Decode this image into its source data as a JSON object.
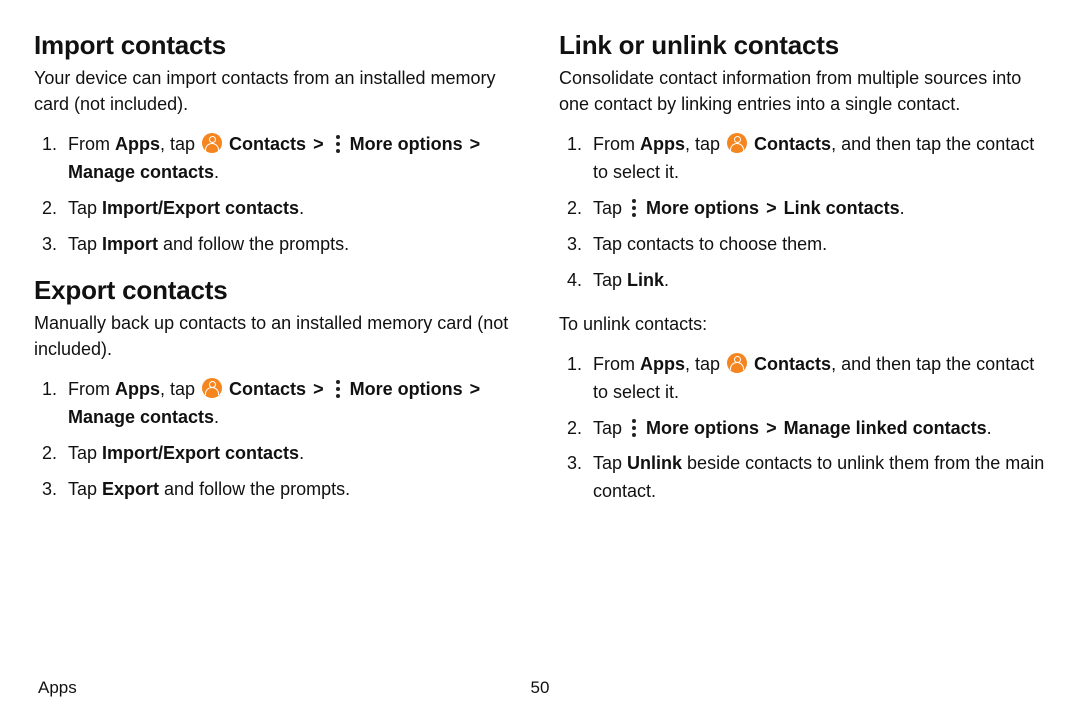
{
  "footer": {
    "section": "Apps",
    "page": "50"
  },
  "left": {
    "import": {
      "heading": "Import contacts",
      "intro": "Your device can import contacts from an installed memory card (not included).",
      "steps": {
        "s1": {
          "prefix": "From ",
          "apps": "Apps",
          "tap": ", tap ",
          "contacts": "Contacts",
          "moreoptions": "More options",
          "manage": "Manage contacts",
          "dot": "."
        },
        "s2": {
          "tap": "Tap ",
          "b": "Import/Export contacts",
          "dot": "."
        },
        "s3": {
          "tap": "Tap ",
          "b": "Import",
          "rest": " and follow the prompts."
        }
      }
    },
    "export": {
      "heading": "Export contacts",
      "intro": "Manually back up contacts to an installed memory card (not included).",
      "steps": {
        "s1": {
          "prefix": "From ",
          "apps": "Apps",
          "tap": ", tap ",
          "contacts": "Contacts",
          "moreoptions": "More options",
          "manage": "Manage contacts",
          "dot": "."
        },
        "s2": {
          "tap": "Tap ",
          "b": "Import/Export contacts",
          "dot": "."
        },
        "s3": {
          "tap": "Tap ",
          "b": "Export",
          "rest": " and follow the prompts."
        }
      }
    }
  },
  "right": {
    "link": {
      "heading": "Link or unlink contacts",
      "intro": "Consolidate contact information from multiple sources into one contact by linking entries into a single contact.",
      "steps": {
        "s1": {
          "prefix": "From ",
          "apps": "Apps",
          "tap": ", tap ",
          "contacts": "Contacts",
          "rest": ", and then tap the contact to select it."
        },
        "s2": {
          "tap": "Tap ",
          "moreoptions": "More options",
          "linkc": "Link contacts",
          "dot": "."
        },
        "s3": {
          "text": "Tap contacts to choose them."
        },
        "s4": {
          "tap": "Tap ",
          "b": "Link",
          "dot": "."
        }
      },
      "unlinkIntro": "To unlink contacts:",
      "unlink": {
        "s1": {
          "prefix": "From ",
          "apps": "Apps",
          "tap": ", tap ",
          "contacts": "Contacts",
          "rest": ", and then tap the contact to select it."
        },
        "s2": {
          "tap": "Tap ",
          "moreoptions": "More options",
          "mlc": "Manage linked contacts",
          "dot": "."
        },
        "s3": {
          "tap": "Tap ",
          "b": "Unlink",
          "rest": " beside contacts to unlink them from the main contact."
        }
      }
    }
  },
  "glyphs": {
    "chevron": ">"
  }
}
